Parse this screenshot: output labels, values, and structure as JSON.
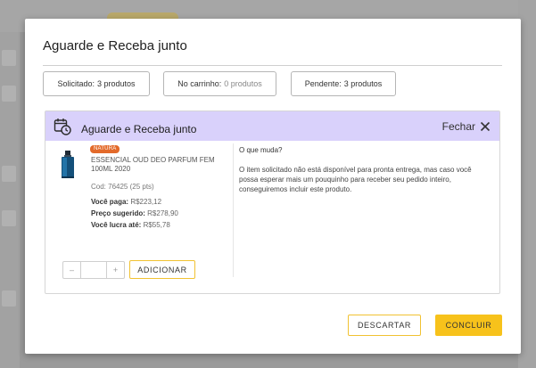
{
  "modal": {
    "title": "Aguarde e Receba junto",
    "summary": [
      {
        "label": "Solicitado:",
        "value": "3 produtos",
        "muted": false
      },
      {
        "label": "No carrinho:",
        "value": "0 produtos",
        "muted": true
      },
      {
        "label": "Pendente:",
        "value": "3 produtos",
        "muted": false
      }
    ],
    "card": {
      "title": "Aguarde e Receba junto",
      "close_label": "Fechar",
      "product": {
        "brand_badge": "NATURA",
        "name": "ESSENCIAL OUD DEO PARFUM FEM 100ML 2020",
        "code": "Cod: 76425 (25 pts)",
        "paid_label": "Você paga:",
        "paid_value": "R$223,12",
        "suggested_label": "Preço sugerido:",
        "suggested_value": "R$278,90",
        "profit_label": "Você lucra até:",
        "profit_value": "R$55,78"
      },
      "question": "O que muda?",
      "answer": "O item solicitado não está disponível para pronta entrega, mas caso você possa esperar mais um pouquinho para receber seu pedido inteiro, conseguiremos incluir este produto.",
      "stepper": {
        "minus": "–",
        "plus": "+",
        "value": ""
      },
      "add_label": "ADICIONAR"
    },
    "discard_label": "DESCARTAR",
    "conclude_label": "CONCLUIR"
  },
  "colors": {
    "accent": "#f7c21b",
    "card_header": "#d9d1fb",
    "badge": "#e36a2a"
  },
  "icons": [
    "calendar-clock-icon",
    "close-icon",
    "perfume-bottle-image"
  ]
}
